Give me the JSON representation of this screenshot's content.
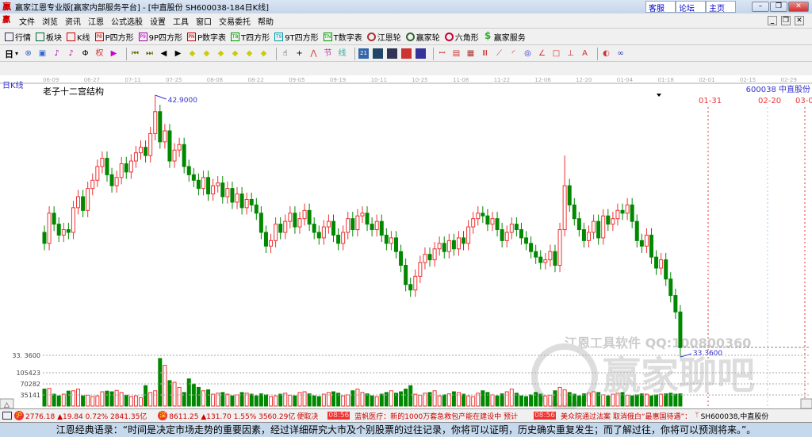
{
  "window": {
    "title": "赢家江恩专业版[赢家内部服务平台] - [中直股份  SH600038-184日K线]",
    "links": [
      "客服",
      "论坛",
      "主页"
    ]
  },
  "menu": [
    "文件",
    "浏览",
    "资讯",
    "江恩",
    "公式选股",
    "设置",
    "工具",
    "窗口",
    "交易委托",
    "帮助"
  ],
  "toolbar1": [
    {
      "label": "行情",
      "icon": "grid-icon",
      "color": "#335"
    },
    {
      "label": "板块",
      "icon": "blocks-icon",
      "color": "#063"
    },
    {
      "label": "K线",
      "icon": "candles-icon",
      "color": "#c00"
    },
    {
      "label": "P四方形",
      "icon": "P8",
      "color": "#c00"
    },
    {
      "label": "9P四方形",
      "icon": "P9",
      "color": "#a0a"
    },
    {
      "label": "P数字表",
      "icon": "PN",
      "color": "#c00"
    },
    {
      "label": "T四方形",
      "icon": "T8",
      "color": "#090"
    },
    {
      "label": "9T四方形",
      "icon": "T9",
      "color": "#09a"
    },
    {
      "label": "T数字表",
      "icon": "TN",
      "color": "#090"
    },
    {
      "label": "江恩轮",
      "icon": "wheel-icon",
      "color": "#a33"
    },
    {
      "label": "赢家轮",
      "icon": "wheel2-icon",
      "color": "#363"
    },
    {
      "label": "六角形",
      "icon": "hexagon-icon",
      "color": "#c03"
    },
    {
      "label": "赢家服务",
      "icon": "dollar-icon",
      "color": "#3a3"
    }
  ],
  "toolbar2": {
    "period": "日"
  },
  "chart": {
    "period_label": "日K线",
    "indicator_title": "老子十二宫结构",
    "stock": "600038  中直股份",
    "date_ticks": [
      "06-09",
      "06-27",
      "07-11",
      "07-25",
      "08-08",
      "08-22",
      "09-05",
      "09-19",
      "10-11",
      "10-25",
      "11-08",
      "11-22",
      "12-06",
      "12-20",
      "01-04",
      "01-18",
      "02-01",
      "02-15",
      "02-29"
    ],
    "future_marks": [
      {
        "label": "01-31",
        "color": "#e33"
      },
      {
        "label": "02-20",
        "color": "#e33"
      },
      {
        "label": "03-0",
        "color": "#e33"
      }
    ],
    "high_label": "42.9000",
    "low_label": "33.3600",
    "high": 42.9,
    "low": 33.36,
    "closes": [
      37.5,
      38.6,
      38.2,
      37.8,
      38.0,
      37.9,
      38.8,
      39.2,
      38.7,
      39.5,
      39.8,
      40.3,
      40.6,
      40.0,
      39.6,
      39.9,
      40.4,
      40.1,
      40.5,
      40.8,
      41.0,
      40.7,
      41.5,
      42.3,
      41.2,
      41.6,
      40.5,
      40.9,
      41.1,
      40.3,
      40.0,
      39.8,
      39.5,
      39.9,
      39.3,
      39.6,
      39.7,
      39.2,
      39.5,
      39.0,
      39.3,
      38.8,
      39.1,
      38.9,
      38.6,
      37.9,
      37.4,
      37.6,
      38.2,
      37.9,
      38.3,
      38.6,
      38.1,
      38.4,
      38.7,
      38.2,
      37.9,
      37.7,
      38.1,
      38.3,
      37.8,
      37.5,
      37.9,
      38.4,
      38.0,
      38.5,
      38.6,
      38.2,
      38.0,
      38.3,
      37.8,
      37.5,
      37.7,
      37.2,
      36.7,
      36.0,
      35.8,
      36.3,
      36.8,
      37.1,
      36.9,
      37.3,
      37.5,
      37.2,
      37.6,
      37.3,
      37.7,
      37.5,
      38.1,
      38.4,
      38.6,
      38.5,
      38.2,
      38.4,
      38.0,
      37.6,
      37.9,
      38.2,
      38.0,
      37.7,
      37.5,
      37.2,
      37.0,
      36.8,
      36.9,
      37.2,
      36.7,
      38.0,
      39.6,
      38.9,
      38.4,
      38.0,
      37.6,
      37.9,
      38.3,
      37.7,
      38.5,
      38.2,
      38.4,
      38.7,
      38.6,
      38.9,
      38.3,
      37.6,
      37.4,
      37.8,
      37.0,
      36.6,
      36.9,
      36.2,
      35.6,
      35.0,
      33.7
    ],
    "volume_axis": [
      "33. 3600",
      "105423",
      "70282",
      "35141"
    ],
    "volumes_k": [
      50,
      52,
      35,
      30,
      35,
      44,
      45,
      50,
      30,
      32,
      28,
      30,
      42,
      44,
      42,
      46,
      40,
      32,
      28,
      30,
      25,
      60,
      40,
      45,
      140,
      120,
      75,
      70,
      55,
      40,
      80,
      65,
      55,
      45,
      48,
      35,
      38,
      40,
      35,
      30,
      33,
      40,
      38,
      35,
      30,
      36,
      33,
      28,
      30,
      35,
      38,
      32,
      30,
      40,
      42,
      36,
      30,
      28,
      35,
      40,
      42,
      38,
      30,
      33,
      45,
      50,
      40,
      36,
      30,
      28,
      35,
      40,
      45,
      38,
      42,
      50,
      60,
      35,
      32,
      38,
      40,
      45,
      30,
      33,
      36,
      42,
      40,
      35,
      30,
      28,
      38,
      45,
      40,
      33,
      30,
      36,
      42,
      50,
      38,
      30,
      28,
      33,
      40,
      35,
      30,
      32,
      45,
      55,
      48,
      40,
      35,
      30,
      36,
      38,
      42,
      40,
      33,
      30,
      35,
      38,
      40,
      32,
      30,
      33,
      36,
      35,
      30,
      33,
      35,
      36,
      38,
      35,
      36
    ],
    "watermark": [
      "江恩工具软件  QQ:100800360",
      "赢家聊吧"
    ],
    "colors": {
      "up": "#e33",
      "down": "#080",
      "label": "#33c"
    }
  },
  "status": {
    "sh": "2776.18 ▲19.84 0.72% 2841.35亿",
    "sz": "8611.25 ▲131.70 1.55% 3560.29亿",
    "ticker": "便取决",
    "news_time": "08:56",
    "news1": "蓝帆医疗：新的1000万套急救包产能在建设中 预计",
    "news2": "美众院通过法案 取消俄白“最惠国待遇”：",
    "stock": "SH600038,中直股份"
  },
  "quote": "江恩经典语录：“时间是决定市场走势的重要因素，经过详细研究大市及个别股票的过往记录，你将可以证明，历史确实重复发生；而了解过往，你将可以预测将来。”。"
}
